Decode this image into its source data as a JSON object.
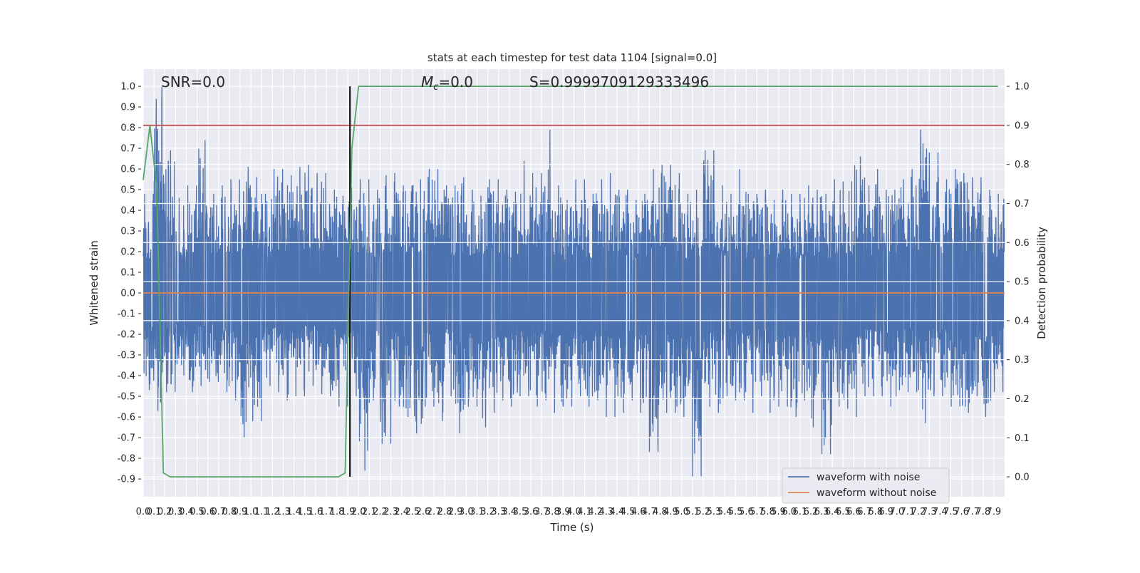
{
  "chart_data": {
    "type": "line",
    "title": "stats at each timestep for test data 1104 [signal=0.0]",
    "xlabel": "Time (s)",
    "ylabel": "Whitened strain",
    "ylabel_right": "Detection probability",
    "xlim": [
      0,
      8.0
    ],
    "ylim": [
      -0.986,
      1.083
    ],
    "ylim_right": [
      -0.051,
      1.044
    ],
    "x_ticks": [
      "0.0",
      "0.1",
      "0.2",
      "0.3",
      "0.4",
      "0.5",
      "0.6",
      "0.7",
      "0.8",
      "0.9",
      "1.0",
      "1.1",
      "1.2",
      "1.3",
      "1.4",
      "1.5",
      "1.6",
      "1.7",
      "1.8",
      "1.9",
      "2.0",
      "2.1",
      "2.2",
      "2.3",
      "2.4",
      "2.5",
      "2.6",
      "2.7",
      "2.8",
      "2.9",
      "3.0",
      "3.1",
      "3.2",
      "3.3",
      "3.4",
      "3.5",
      "3.6",
      "3.7",
      "3.8",
      "3.9",
      "4.0",
      "4.1",
      "4.2",
      "4.3",
      "4.4",
      "4.5",
      "4.6",
      "4.7",
      "4.8",
      "4.9",
      "5.0",
      "5.1",
      "5.2",
      "5.3",
      "5.4",
      "5.5",
      "5.6",
      "5.7",
      "5.8",
      "5.9",
      "6.0",
      "6.1",
      "6.2",
      "6.3",
      "6.4",
      "6.5",
      "6.6",
      "6.7",
      "6.8",
      "6.9",
      "7.0",
      "7.1",
      "7.2",
      "7.3",
      "7.4",
      "7.5",
      "7.6",
      "7.7",
      "7.8",
      "7.9"
    ],
    "y_ticks": [
      "1.0",
      "0.9",
      "0.8",
      "0.7",
      "0.6",
      "0.5",
      "0.4",
      "0.3",
      "0.2",
      "0.1",
      "0.0",
      "-0.1",
      "-0.2",
      "-0.3",
      "-0.4",
      "-0.5",
      "-0.6",
      "-0.7",
      "-0.8",
      "-0.9"
    ],
    "y_ticks_right": [
      "1.0",
      "0.9",
      "0.8",
      "0.7",
      "0.6",
      "0.5",
      "0.4",
      "0.3",
      "0.2",
      "0.1",
      "0.0"
    ],
    "grid": true,
    "legend_position": "lower-right",
    "annotations": {
      "snr": "SNR=0.0",
      "mc": "=0.0",
      "mc_symbol": "M",
      "mc_sub": "c",
      "s": "S=0.9999709129333496"
    },
    "series": [
      {
        "name": "waveform with noise",
        "color": "#4c72b0",
        "axis": "left",
        "bin_width_s": 0.1,
        "upper_envelope": [
          0.48,
          1.0,
          0.69,
          0.46,
          0.52,
          0.74,
          0.48,
          0.52,
          0.55,
          0.61,
          0.56,
          0.48,
          0.6,
          0.57,
          0.61,
          0.62,
          0.58,
          0.5,
          0.47,
          0.51,
          0.55,
          0.5,
          0.57,
          0.58,
          0.52,
          0.55,
          0.6,
          0.6,
          0.52,
          0.56,
          0.5,
          0.47,
          0.55,
          0.5,
          0.49,
          0.64,
          0.58,
          0.79,
          0.52,
          0.45,
          0.55,
          0.48,
          0.55,
          0.58,
          0.5,
          0.45,
          0.48,
          0.6,
          0.62,
          0.58,
          0.48,
          0.5,
          0.69,
          0.52,
          0.48,
          0.6,
          0.48,
          0.5,
          0.45,
          0.5,
          0.48,
          0.52,
          0.5,
          0.48,
          0.55,
          0.54,
          0.66,
          0.52,
          0.6,
          0.5,
          0.55,
          0.6,
          0.79,
          0.68,
          0.55,
          0.6,
          0.58,
          0.56,
          0.5,
          0.48
        ],
        "lower_envelope": [
          -0.47,
          -0.57,
          -0.48,
          -0.4,
          -0.48,
          -0.45,
          -0.43,
          -0.48,
          -0.52,
          -0.7,
          -0.62,
          -0.45,
          -0.48,
          -0.52,
          -0.5,
          -0.45,
          -0.49,
          -0.5,
          -0.55,
          -0.5,
          -0.86,
          -0.52,
          -0.73,
          -0.55,
          -0.6,
          -0.68,
          -0.55,
          -0.62,
          -0.5,
          -0.68,
          -0.55,
          -0.65,
          -0.58,
          -0.52,
          -0.55,
          -0.5,
          -0.55,
          -0.52,
          -0.58,
          -0.55,
          -0.5,
          -0.55,
          -0.52,
          -0.6,
          -0.58,
          -0.52,
          -0.58,
          -0.77,
          -0.58,
          -0.58,
          -0.6,
          -0.89,
          -0.55,
          -0.58,
          -0.5,
          -0.52,
          -0.58,
          -0.5,
          -0.58,
          -0.55,
          -0.6,
          -0.52,
          -0.65,
          -0.78,
          -0.55,
          -0.56,
          -0.6,
          -0.5,
          -0.5,
          -0.55,
          -0.47,
          -0.48,
          -0.63,
          -0.5,
          -0.5,
          -0.55,
          -0.58,
          -0.5,
          -0.6,
          -0.48
        ]
      },
      {
        "name": "waveform without noise",
        "color": "#dd8452",
        "axis": "left",
        "x": [
          0,
          8.0
        ],
        "y": [
          0.0,
          0.0
        ]
      },
      {
        "color": "#55a868",
        "axis": "right",
        "x": [
          0,
          0.0625,
          0.125,
          0.1875,
          0.25,
          1.8125,
          1.875,
          1.9375,
          2.0,
          7.9375
        ],
        "y": [
          0.76,
          0.9,
          0.74,
          0.01,
          0.0,
          0.0,
          0.01,
          0.84,
          1.0,
          1.0
        ]
      }
    ],
    "threshold": {
      "axis": "right",
      "value": 0.9,
      "color": "#c44e52"
    },
    "marker_time": {
      "x": 1.92,
      "color": "#000000"
    }
  }
}
